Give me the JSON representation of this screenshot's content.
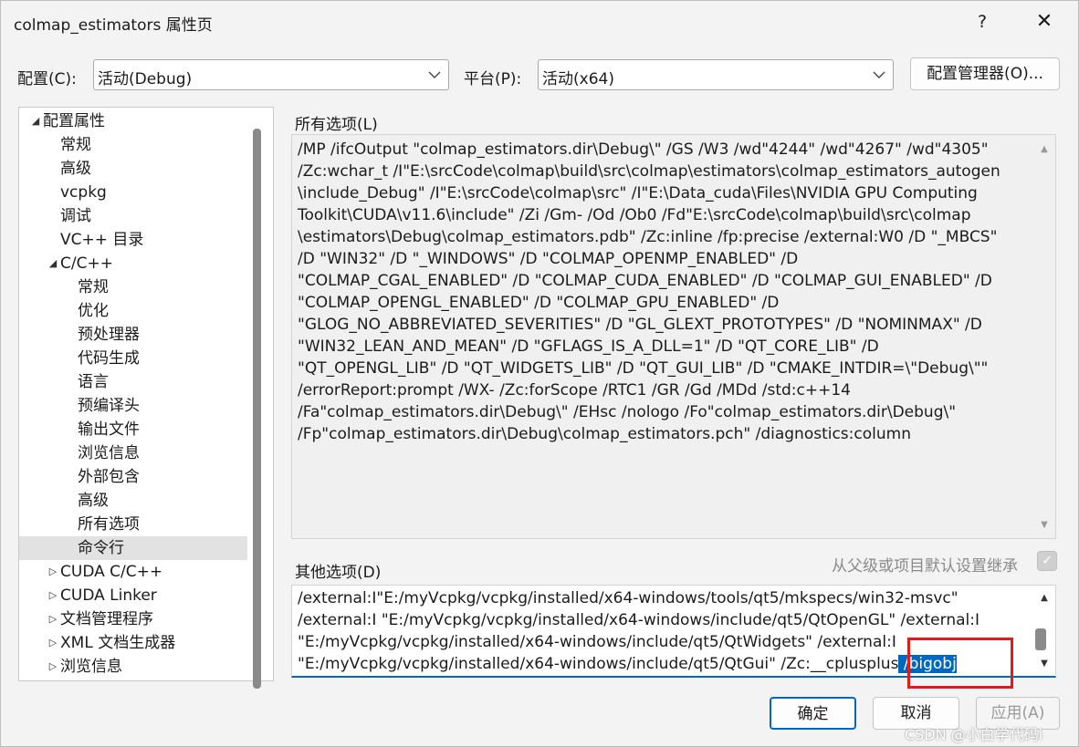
{
  "window": {
    "title": "colmap_estimators 属性页",
    "help_glyph": "?",
    "close_glyph": "✕"
  },
  "toolbar": {
    "config_label": "配置(C):",
    "config_value": "活动(Debug)",
    "platform_label": "平台(P):",
    "platform_value": "活动(x64)",
    "config_manager_button": "配置管理器(O)..."
  },
  "tree": {
    "items": [
      {
        "label": "配置属性",
        "indent": 0,
        "expander": "◢"
      },
      {
        "label": "常规",
        "indent": 1,
        "expander": ""
      },
      {
        "label": "高级",
        "indent": 1,
        "expander": ""
      },
      {
        "label": "vcpkg",
        "indent": 1,
        "expander": ""
      },
      {
        "label": "调试",
        "indent": 1,
        "expander": ""
      },
      {
        "label": "VC++ 目录",
        "indent": 1,
        "expander": ""
      },
      {
        "label": "C/C++",
        "indent": 1,
        "expander": "◢"
      },
      {
        "label": "常规",
        "indent": 2,
        "expander": ""
      },
      {
        "label": "优化",
        "indent": 2,
        "expander": ""
      },
      {
        "label": "预处理器",
        "indent": 2,
        "expander": ""
      },
      {
        "label": "代码生成",
        "indent": 2,
        "expander": ""
      },
      {
        "label": "语言",
        "indent": 2,
        "expander": ""
      },
      {
        "label": "预编译头",
        "indent": 2,
        "expander": ""
      },
      {
        "label": "输出文件",
        "indent": 2,
        "expander": ""
      },
      {
        "label": "浏览信息",
        "indent": 2,
        "expander": ""
      },
      {
        "label": "外部包含",
        "indent": 2,
        "expander": ""
      },
      {
        "label": "高级",
        "indent": 2,
        "expander": ""
      },
      {
        "label": "所有选项",
        "indent": 2,
        "expander": ""
      },
      {
        "label": "命令行",
        "indent": 2,
        "expander": "",
        "selected": true
      },
      {
        "label": "CUDA C/C++",
        "indent": 1,
        "expander": "▷"
      },
      {
        "label": "CUDA Linker",
        "indent": 1,
        "expander": "▷"
      },
      {
        "label": "文档管理程序",
        "indent": 1,
        "expander": "▷"
      },
      {
        "label": "XML 文档生成器",
        "indent": 1,
        "expander": "▷"
      },
      {
        "label": "浏览信息",
        "indent": 1,
        "expander": "▷"
      }
    ]
  },
  "all_options": {
    "label": "所有选项(L)",
    "text": "/MP /ifcOutput \"colmap_estimators.dir\\Debug\\\" /GS /W3 /wd\"4244\" /wd\"4267\" /wd\"4305\" /Zc:wchar_t /I\"E:\\srcCode\\colmap\\build\\src\\colmap\\estimators\\colmap_estimators_autogen\\include_Debug\" /I\"E:\\srcCode\\colmap\\src\" /I\"E:\\Data_cuda\\Files\\NVIDIA GPU Computing Toolkit\\CUDA\\v11.6\\include\" /Zi /Gm- /Od /Ob0 /Fd\"E:\\srcCode\\colmap\\build\\src\\colmap\\estimators\\Debug\\colmap_estimators.pdb\" /Zc:inline /fp:precise /external:W0 /D \"_MBCS\" /D \"WIN32\" /D \"_WINDOWS\" /D \"COLMAP_OPENMP_ENABLED\" /D \"COLMAP_CGAL_ENABLED\" /D \"COLMAP_CUDA_ENABLED\" /D \"COLMAP_GUI_ENABLED\" /D \"COLMAP_OPENGL_ENABLED\" /D \"COLMAP_GPU_ENABLED\" /D \"GLOG_NO_ABBREVIATED_SEVERITIES\" /D \"GL_GLEXT_PROTOTYPES\" /D \"NOMINMAX\" /D \"WIN32_LEAN_AND_MEAN\" /D \"GFLAGS_IS_A_DLL=1\" /D \"QT_CORE_LIB\" /D \"QT_OPENGL_LIB\" /D \"QT_WIDGETS_LIB\" /D \"QT_GUI_LIB\" /D \"CMAKE_INTDIR=\\\"Debug\\\"\" /errorReport:prompt /WX- /Zc:forScope /RTC1 /GR /Gd /MDd /std:c++14 /Fa\"colmap_estimators.dir\\Debug\\\" /EHsc /nologo /Fo\"colmap_estimators.dir\\Debug\\\" /Fp\"colmap_estimators.dir\\Debug\\colmap_estimators.pch\" /diagnostics:column",
    "lines": [
      "/MP /ifcOutput \"colmap_estimators.dir\\Debug\\\" /GS /W3 /wd\"4244\" /wd\"4267\" /wd\"4305\"",
      "/Zc:wchar_t /I\"E:\\srcCode\\colmap\\build\\src\\colmap\\estimators\\colmap_estimators_autogen",
      "\\include_Debug\" /I\"E:\\srcCode\\colmap\\src\" /I\"E:\\Data_cuda\\Files\\NVIDIA GPU Computing",
      "Toolkit\\CUDA\\v11.6\\include\" /Zi /Gm- /Od /Ob0 /Fd\"E:\\srcCode\\colmap\\build\\src\\colmap",
      "\\estimators\\Debug\\colmap_estimators.pdb\" /Zc:inline /fp:precise /external:W0 /D \"_MBCS\"",
      "/D \"WIN32\" /D \"_WINDOWS\" /D \"COLMAP_OPENMP_ENABLED\" /D",
      "\"COLMAP_CGAL_ENABLED\" /D \"COLMAP_CUDA_ENABLED\" /D \"COLMAP_GUI_ENABLED\" /D",
      "\"COLMAP_OPENGL_ENABLED\" /D \"COLMAP_GPU_ENABLED\" /D",
      "\"GLOG_NO_ABBREVIATED_SEVERITIES\" /D \"GL_GLEXT_PROTOTYPES\" /D \"NOMINMAX\" /D",
      "\"WIN32_LEAN_AND_MEAN\" /D \"GFLAGS_IS_A_DLL=1\" /D \"QT_CORE_LIB\" /D",
      "\"QT_OPENGL_LIB\" /D \"QT_WIDGETS_LIB\" /D \"QT_GUI_LIB\" /D \"CMAKE_INTDIR=\\\"Debug\\\"\"",
      "/errorReport:prompt /WX- /Zc:forScope /RTC1 /GR /Gd /MDd /std:c++14",
      "/Fa\"colmap_estimators.dir\\Debug\\\" /EHsc /nologo /Fo\"colmap_estimators.dir\\Debug\\\"",
      "/Fp\"colmap_estimators.dir\\Debug\\colmap_estimators.pch\" /diagnostics:column"
    ]
  },
  "other_options": {
    "label": "其他选项(D)",
    "inherit_label": "从父级或项目默认设置继承",
    "inherit_checked": true,
    "lines": [
      "/external:I\"E:/myVcpkg/vcpkg/installed/x64-windows/tools/qt5/mkspecs/win32-msvc\"",
      "/external:I \"E:/myVcpkg/vcpkg/installed/x64-windows/include/qt5/QtOpenGL\" /external:I",
      "\"E:/myVcpkg/vcpkg/installed/x64-windows/include/qt5/QtWidgets\" /external:I"
    ],
    "last_line_prefix": "\"E:/myVcpkg/vcpkg/installed/x64-windows/include/qt5/QtGui\" /Zc:__cplusplus",
    "selected_text": " /bigobj"
  },
  "footer": {
    "ok": "确定",
    "cancel": "取消",
    "apply": "应用(A)"
  },
  "watermark": "CSDN @小白学代码i",
  "colors": {
    "accent": "#0067c0",
    "highlight_box": "#e61919",
    "dialog_bg": "#f3f3f3",
    "selected_tree_bg": "#e2e2e2"
  }
}
